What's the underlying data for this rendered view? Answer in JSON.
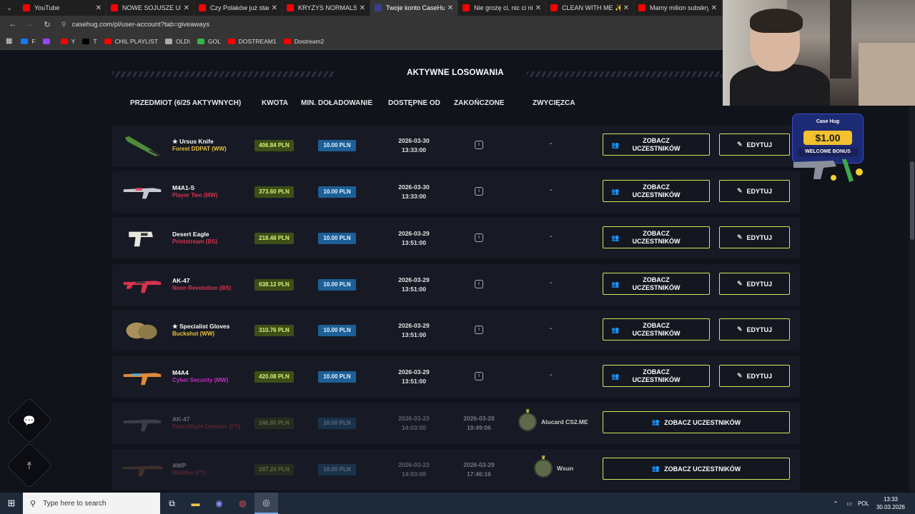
{
  "browser": {
    "tabs": [
      {
        "title": "YouTube",
        "color": "#ff0000",
        "active": false
      },
      {
        "title": "NOWE SOJUSZE UKR",
        "color": "#ff0000",
        "active": false
      },
      {
        "title": "Czy Polaków już stać",
        "color": "#ff0000",
        "active": false
      },
      {
        "title": "KRYZYS NORMALSÓW",
        "color": "#ff0000",
        "active": false
      },
      {
        "title": "Twoje konto CaseHug",
        "color": "#3a3f8f",
        "active": true
      },
      {
        "title": "Nie grożę ci, nic ci nie",
        "color": "#ff0000",
        "active": false
      },
      {
        "title": "CLEAN WITH ME ✨ sp",
        "color": "#ff0000",
        "active": false
      },
      {
        "title": "Mamy milion subskry",
        "color": "#ff0000",
        "active": false
      }
    ],
    "url": "casehug.com/pl/user-account?tab=giveaways",
    "bookmarks": [
      {
        "label": "F",
        "color": "#1877f2"
      },
      {
        "label": "",
        "color": "#9146ff"
      },
      {
        "label": "Y",
        "color": "#ff0000"
      },
      {
        "label": "T",
        "color": "#000000"
      },
      {
        "label": "CHIL PLAYLIST",
        "color": "#ff0000"
      },
      {
        "label": "OLD\\",
        "color": "#aaaaaa"
      },
      {
        "label": "GOL",
        "color": "#3bb34a"
      },
      {
        "label": "DOSTREAM1",
        "color": "#ff0000"
      },
      {
        "label": "Dostream2",
        "color": "#ff0000"
      }
    ]
  },
  "page": {
    "section_title": "AKTYWNE LOSOWANIA",
    "columns": {
      "item": "PRZEDMIOT (6/25 AKTYWNYCH)",
      "amount": "KWOTA",
      "min_load": "MIN. DOŁADOWANIE",
      "available_from": "DOSTĘPNE OD",
      "ended": "ZAKOŃCZONE",
      "winner": "ZWYCIĘZCA"
    },
    "view_participants_label_1": "ZOBACZ",
    "view_participants_label_2": "UCZESTNIKÓW",
    "view_participants_wide": "ZOBACZ UCZESTNIKÓW",
    "edit_label": "EDYTUJ",
    "rows": [
      {
        "name": "★ Ursus Knife",
        "wear": "Forest DDPAT (WW)",
        "wear_color": "#e8c23a",
        "amount": "406.84 PLN",
        "min": "10.00 PLN",
        "date": "2026-03-30",
        "time": "13:33:00",
        "winner": "-",
        "active": true
      },
      {
        "name": "M4A1-S",
        "wear": "Player Two (MW)",
        "wear_color": "#d8324f",
        "amount": "373.60 PLN",
        "min": "10.00 PLN",
        "date": "2026-03-30",
        "time": "13:33:00",
        "winner": "-",
        "active": true
      },
      {
        "name": "Desert Eagle",
        "wear": "Printstream (BS)",
        "wear_color": "#d8324f",
        "amount": "218.48 PLN",
        "min": "10.00 PLN",
        "date": "2026-03-29",
        "time": "13:51:00",
        "winner": "-",
        "active": true
      },
      {
        "name": "AK-47",
        "wear": "Neon Revolution (BS)",
        "wear_color": "#d8324f",
        "amount": "638.12 PLN",
        "min": "10.00 PLN",
        "date": "2026-03-29",
        "time": "13:51:00",
        "winner": "-",
        "active": true
      },
      {
        "name": "★ Specialist Gloves",
        "wear": "Buckshot (WW)",
        "wear_color": "#e8c23a",
        "amount": "310.76 PLN",
        "min": "10.00 PLN",
        "date": "2026-03-29",
        "time": "13:51:00",
        "winner": "-",
        "active": true
      },
      {
        "name": "M4A4",
        "wear": "Cyber Security (MW)",
        "wear_color": "#c02ec4",
        "amount": "420.08 PLN",
        "min": "10.00 PLN",
        "date": "2026-03-29",
        "time": "13:51:00",
        "winner": "-",
        "active": true
      },
      {
        "name": "AK-47",
        "wear": "Searchlight Dynamo (FT)",
        "wear_color": "#d8324f",
        "amount": "246.80 PLN",
        "min": "10.00 PLN",
        "date": "2026-03-23",
        "time": "14:03:00",
        "end_date": "2026-03-28",
        "end_time": "19:49:06",
        "winner": "Alucard CS2.ME",
        "active": false
      },
      {
        "name": "AWP",
        "wear": "Wildfire (FT)",
        "wear_color": "#d8324f",
        "amount": "287.24 PLN",
        "min": "10.00 PLN",
        "date": "2026-03-23",
        "time": "14:03:00",
        "end_date": "2026-03-29",
        "end_time": "17:46:16",
        "winner": "Wsun",
        "active": false
      }
    ]
  },
  "promo": {
    "brand": "Case Hug",
    "amount": "$1.00",
    "label": "WELCOME BONUS"
  },
  "taskbar": {
    "search_placeholder": "Type here to search",
    "lang": "POL",
    "time": "13:33",
    "date": "30.03.2026"
  }
}
